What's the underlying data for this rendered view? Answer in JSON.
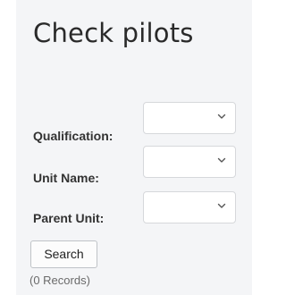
{
  "page": {
    "title": "Check pilots"
  },
  "filters": [
    {
      "label": "Qualification:",
      "value": ""
    },
    {
      "label": "Unit Name:",
      "value": ""
    },
    {
      "label": "Parent Unit:",
      "value": ""
    }
  ],
  "actions": {
    "search_label": "Search"
  },
  "results": {
    "count_text": "(0 Records)"
  },
  "icons": {
    "dropdown": "chevron-down-icon"
  },
  "colors": {
    "panel_bg": "#f4f5f7",
    "title_text": "#2a2a2a",
    "muted_text": "#6a6a6a"
  }
}
